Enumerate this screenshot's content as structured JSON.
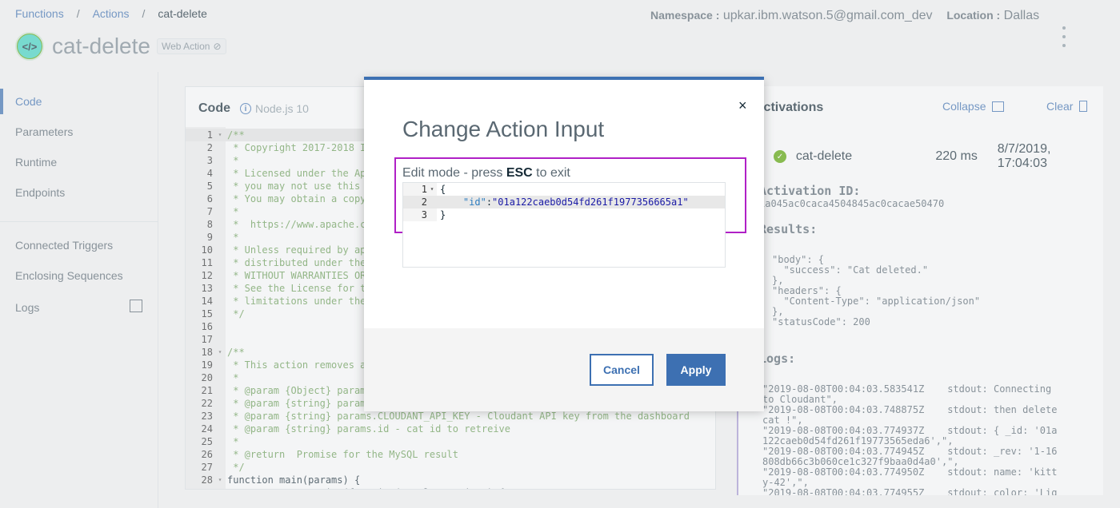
{
  "breadcrumb": {
    "items": [
      "Functions",
      "Actions"
    ],
    "current": "cat-delete"
  },
  "header": {
    "title": "cat-delete",
    "tag": "Web Action",
    "namespace_label": "Namespace :",
    "namespace_value": "upkar.ibm.watson.5@gmail.com_dev",
    "location_label": "Location :",
    "location_value": "Dallas"
  },
  "sidebar": {
    "items": [
      "Code",
      "Parameters",
      "Runtime",
      "Endpoints",
      "Connected Triggers",
      "Enclosing Sequences",
      "Logs"
    ],
    "active": "Code"
  },
  "code_panel": {
    "title": "Code",
    "runtime": "Node.js 10",
    "lines": [
      "/**",
      " * Copyright 2017-2018 I",
      " *",
      " * Licensed under the Ap",
      " * you may not use this",
      " * You may obtain a copy",
      " *",
      " *  https://www.apache.c",
      " *",
      " * Unless required by ap",
      " * distributed under the",
      " * WITHOUT WARRANTIES OR",
      " * See the License for t",
      " * limitations under the",
      " */",
      "",
      "",
      "/**",
      " * This action removes a",
      " *",
      " * @param {Object} param",
      " * @param {string} param",
      " * @param {string} params.CLOUDANT_API_KEY - Cloudant API key from the dashboard",
      " * @param {string} params.id - cat id to retreive",
      " *",
      " * @return  Promise for the MySQL result",
      " */",
      "function main(params) {",
      "  return new Promise(function(resolve, reject) {"
    ]
  },
  "activations": {
    "title": "Activations",
    "collapse_label": "Collapse",
    "clear_label": "Clear",
    "name": "cat-delete",
    "duration": "220 ms",
    "timestamp": "8/7/2019, 17:04:03",
    "id_heading": "Activation ID:",
    "id_value": "1a045ac0caca4504845ac0cacae50470",
    "results_heading": "Results:",
    "results_text": "\"body\": {\n  \"success\": \"Cat deleted.\"\n},\n\"headers\": {\n  \"Content-Type\": \"application/json\"\n},\n\"statusCode\": 200",
    "logs_heading": "Logs:",
    "logs_text": "\"2019-08-08T00:04:03.583541Z    stdout: Connecting\nto Cloudant\",\n\"2019-08-08T00:04:03.748875Z    stdout: then delete\ncat !\",\n\"2019-08-08T00:04:03.774937Z    stdout: { _id: '01a\n122caeb0d54fd261f19773565eda6',\",\n\"2019-08-08T00:04:03.774945Z    stdout: _rev: '1-16\n808db66c3b060ce1c327f9baa0d4a0',\",\n\"2019-08-08T00:04:03.774950Z    stdout: name: 'kitt\ny-42',\",\n\"2019-08-08T00:04:03.774955Z    stdout: color: 'Lig"
  },
  "modal": {
    "title": "Change Action Input",
    "close_glyph": "×",
    "edit_hint_prefix": "Edit mode - press ",
    "edit_hint_key": "ESC",
    "edit_hint_suffix": " to exit",
    "json_lines": [
      "{",
      "    \"id\":\"01a122caeb0d54fd261f1977356665a1\"",
      "}"
    ],
    "json_key": "\"id\"",
    "json_value": "\"01a122caeb0d54fd261f1977356665a1\"",
    "cancel_label": "Cancel",
    "apply_label": "Apply"
  },
  "colors": {
    "accent": "#3d70b2",
    "edit_outline": "#b020c6",
    "success": "#5aa700"
  }
}
